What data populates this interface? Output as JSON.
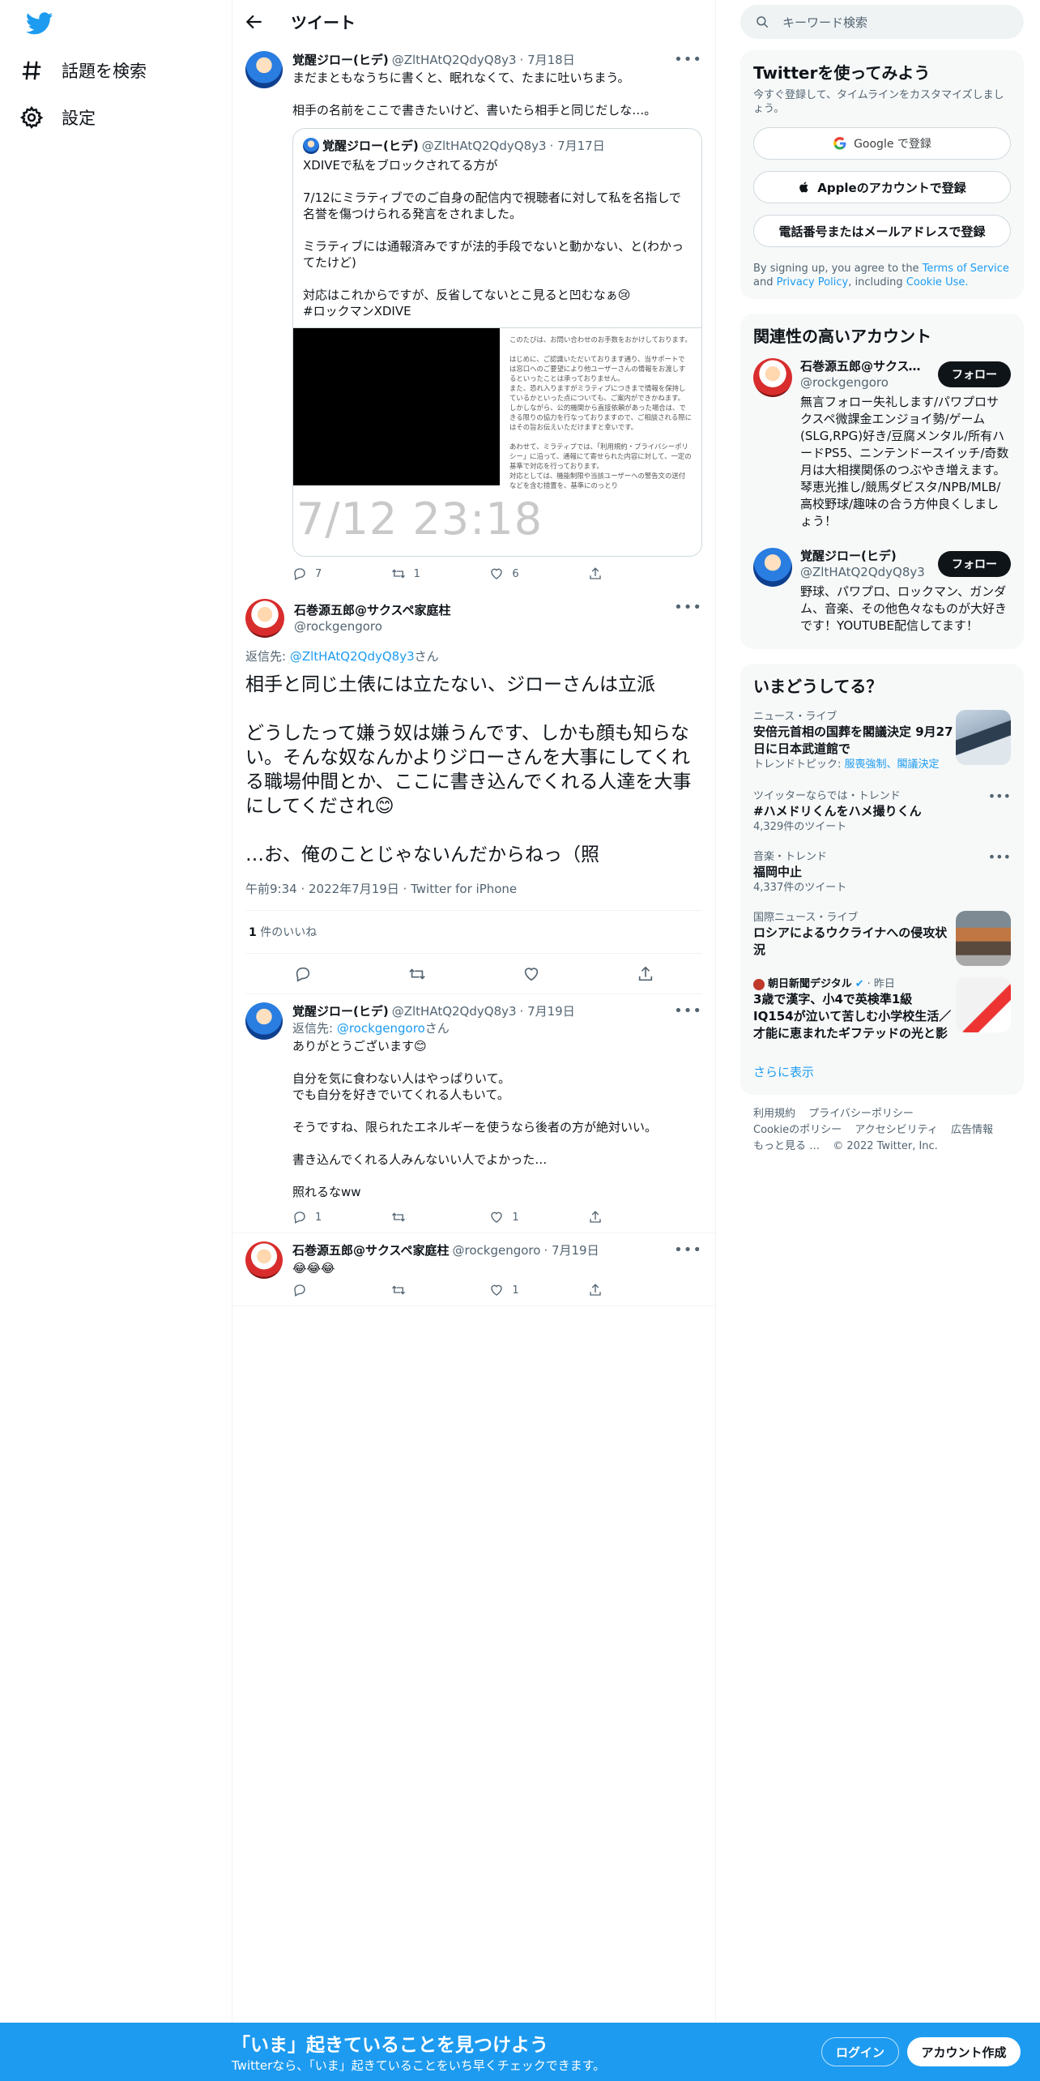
{
  "nav": {
    "explore_label": "話題を検索",
    "settings_label": "設定"
  },
  "header": {
    "title": "ツイート"
  },
  "tweet1": {
    "name": "覚醒ジロー(ヒデ)",
    "handle": "@ZltHAtQ2QdyQ8y3",
    "date": "· 7月18日",
    "text": "まだまともなうちに書くと、眠れなくて、たまに吐いちまう。\n\n相手の名前をここで書きたいけど、書いたら相手と同じだしな…。",
    "quote": {
      "name": "覚醒ジロー(ヒデ)",
      "handle": "@ZltHAtQ2QdyQ8y3",
      "date": "· 7月17日",
      "text": "XDIVEで私をブロックされてる方が\n\n7/12にミラティブでのご自身の配信内で視聴者に対して私を名指しで名誉を傷つけられる発言をされました。\n\nミラティブには通報済みですが法的手段でないと動かない、と(わかってたけど)\n\n対応はこれからですが、反省してないとこ見ると凹むなぁ😢\n#ロックマンXDIVE",
      "image_time": "7/12 23:18",
      "image_text": "このたびは、お問い合わせのお手数をおかけしております。\n\nはじめに、ご認識いただいております通り、当サポートでは窓口へのご要望により他ユーザーさんの情報をお渡しするといったことは承っておりません。\nまた、恐れ入りますがミラティブにつきまで情報を保持しているかといった点についても、ご案内ができかねます。\nしかしながら、公的機関から直接依頼があった場合は、できる限りの協力を行なっておりますので、ご相談される際にはその旨お伝えいただけますと幸いです。\n\nあわせて、ミラティブでは、「利用規約・プライバシーポリシー」に沿って、通報にて寄せられた内容に対して、一定の基準で対応を行っております。\n対応としては、機能制限や当該ユーザーへの警告文の送付などを含む措置を、基準にのっとり"
    },
    "replies": "7",
    "retweets": "1",
    "likes": "6"
  },
  "main": {
    "name": "石巻源五郎@サクスペ家庭柱",
    "handle": "@rockgengoro",
    "reply_prefix": "返信先: ",
    "reply_handle": "@ZltHAtQ2QdyQ8y3",
    "reply_suffix": "さん",
    "text": "相手と同じ土俵には立たない、ジローさんは立派\n\nどうしたって嫌う奴は嫌うんです、しかも顔も知らない。そんな奴なんかよりジローさんを大事にしてくれる職場仲間とか、ここに書き込んでくれる人達を大事にしてくだされ😊\n\n…お、俺のことじゃないんだからねっ（照",
    "meta": "午前9:34 · 2022年7月19日 · Twitter for iPhone",
    "likes_count": "1",
    "likes_label": " 件のいいね"
  },
  "tweet3": {
    "name": "覚醒ジロー(ヒデ)",
    "handle": "@ZltHAtQ2QdyQ8y3",
    "date": "· 7月19日",
    "reply_prefix": "返信先: ",
    "reply_handle": "@rockgengoro",
    "reply_suffix": "さん",
    "text": "ありがとうございます😊\n\n自分を気に食わない人はやっぱりいて。\nでも自分を好きでいてくれる人もいて。\n\nそうですね、限られたエネルギーを使うなら後者の方が絶対いい。\n\n書き込んでくれる人みんないい人でよかった…\n\n照れるなww",
    "replies": "1",
    "retweets": "",
    "likes": "1"
  },
  "tweet4": {
    "name": "石巻源五郎@サクスペ家庭柱",
    "handle": "@rockgengoro",
    "date": "· 7月19日",
    "text": "😂😂😂",
    "replies": "",
    "retweets": "",
    "likes": "1"
  },
  "search": {
    "placeholder": "キーワード検索"
  },
  "signup": {
    "title": "Twitterを使ってみよう",
    "subtitle": "今すぐ登録して、タイムラインをカスタマイズしましょう。",
    "google": "Google で登録",
    "apple": "Appleのアカウントで登録",
    "phone": "電話番号またはメールアドレスで登録",
    "terms_pre": "By signing up, you agree to the ",
    "terms_tos": "Terms of Service",
    "terms_and": " and ",
    "terms_privacy": "Privacy Policy",
    "terms_inc": ", including ",
    "terms_cookie": "Cookie Use."
  },
  "related": {
    "title": "関連性の高いアカウント",
    "accounts": [
      {
        "name": "石巻源五郎@サクスペ家庭柱",
        "handle": "@rockgengoro",
        "bio": "無言フォロー失礼します/パワプロサクスペ微課金エンジョイ勢/ゲーム(SLG,RPG)好き/豆腐メンタル/所有ハードPS5、ニンテンドースイッチ/奇数月は大相撲関係のつぶやき増えます。琴恵光推し/競馬ダビスタ/NPB/MLB/高校野球/趣味の合う方仲良くしましょう！",
        "follow": "フォロー"
      },
      {
        "name": "覚醒ジロー(ヒデ)",
        "handle": "@ZltHAtQ2QdyQ8y3",
        "bio": "野球、パワプロ、ロックマン、ガンダム、音楽、その他色々なものが大好きです！YOUTUBE配信してます！",
        "follow": "フォロー"
      }
    ]
  },
  "trends": {
    "title": "いまどうしてる？",
    "items": [
      {
        "category": "ニュース・ライブ",
        "title": "安倍元首相の国葬を閣議決定 9月27日に日本武道館で",
        "extra_prefix": "トレンドトピック: ",
        "extra_links": "服喪強制、閣議決定"
      },
      {
        "category": "ツイッターならでは・トレンド",
        "title": "#ハメドリくんをハメ撮りくん",
        "count": "4,329件のツイート"
      },
      {
        "category": "音楽・トレンド",
        "title": "福岡中止",
        "count": "4,337件のツイート"
      },
      {
        "category": "国際ニュース・ライブ",
        "title": "ロシアによるウクライナへの侵攻状況"
      },
      {
        "source": "朝日新聞デジタル",
        "time": "· 昨日",
        "title": "3歳で漢字、小4で英検準1級 IQ154が泣いて苦しむ小学校生活／才能に恵まれたギフテッドの光と影"
      }
    ],
    "show_more": "さらに表示"
  },
  "footer": {
    "links": [
      "利用規約",
      "プライバシーポリシー",
      "Cookieのポリシー",
      "アクセシビリティ",
      "広告情報",
      "もっと見る …",
      "© 2022 Twitter, Inc."
    ]
  },
  "bottom": {
    "title": "「いま」起きていることを見つけよう",
    "subtitle": "Twitterなら、「いま」起きていることをいち早くチェックできます。",
    "login": "ログイン",
    "signup": "アカウント作成"
  },
  "colors": {
    "accent": "#1d9bf0",
    "text": "#0f1419",
    "muted": "#536471"
  }
}
